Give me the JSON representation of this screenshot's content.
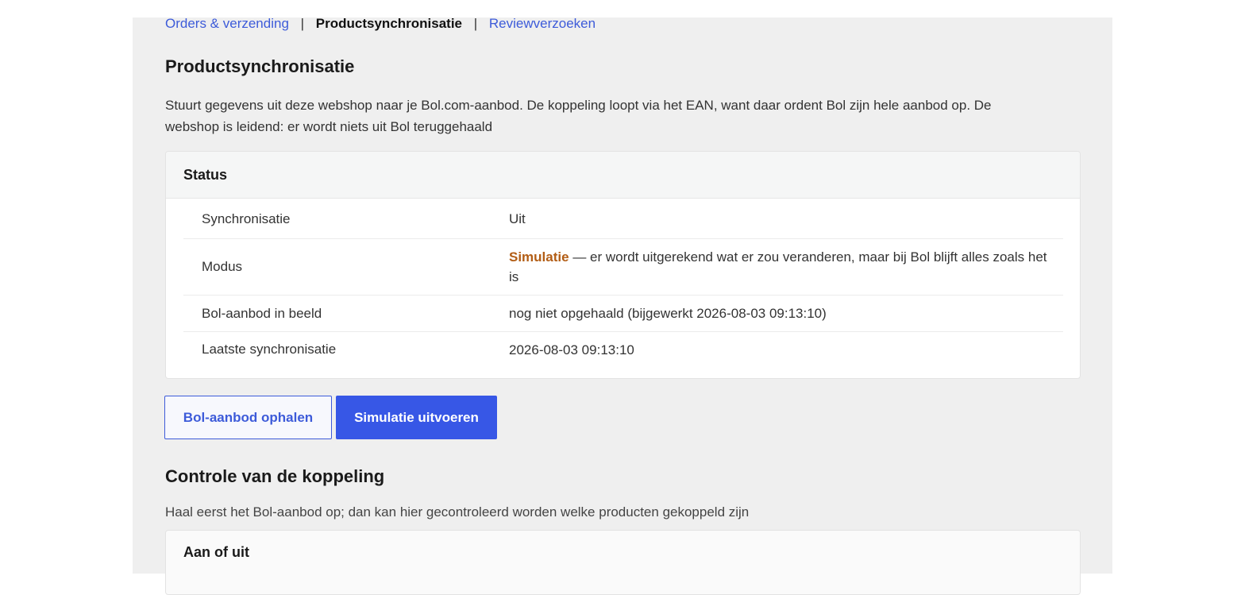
{
  "tabs": [
    {
      "label": "Orders & verzending",
      "active": false
    },
    {
      "label": "Productsynchronisatie",
      "active": true
    },
    {
      "label": "Reviewverzoeken",
      "active": false
    }
  ],
  "tab_separator": "|",
  "section": {
    "title": "Productsynchronisatie",
    "description": "Stuurt gegevens uit deze webshop naar je Bol.com-aanbod. De koppeling loopt via het EAN, want daar ordent Bol zijn hele aanbod op. De webshop is leidend: er wordt niets uit Bol teruggehaald"
  },
  "status": {
    "title": "Status",
    "rows": [
      {
        "label": "Synchronisatie",
        "value": "Uit"
      },
      {
        "label": "Modus",
        "highlight": "Simulatie",
        "value": " — er wordt uitgerekend wat er zou veranderen, maar bij Bol blijft alles zoals het is"
      },
      {
        "label": "Bol-aanbod in beeld",
        "value": "nog niet opgehaald (bijgewerkt 2026-08-03 09:13:10)"
      },
      {
        "label": "Laatste synchronisatie",
        "value": "2026-08-03 09:13:10"
      }
    ]
  },
  "buttons": {
    "fetch_label": "Bol-aanbod ophalen",
    "simulate_label": "Simulatie uitvoeren"
  },
  "control": {
    "title": "Controle van de koppeling",
    "description": "Haal eerst het Bol-aanbod op; dan kan hier gecontroleerd worden welke producten gekoppeld zijn",
    "card_title": "Aan of uit"
  },
  "colors": {
    "link": "#3d5bd9",
    "primary": "#3757e6",
    "simulation": "#b25d15",
    "panel_bg": "#efefef"
  }
}
